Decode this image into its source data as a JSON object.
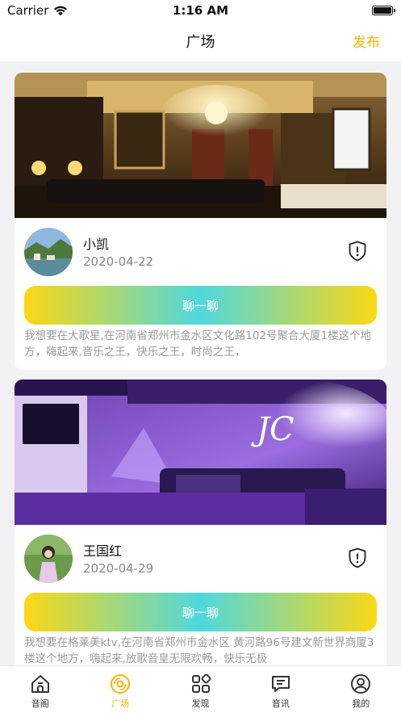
{
  "status_bar": {
    "carrier": "Carrier",
    "time": "1:16 AM"
  },
  "nav": {
    "title": "广场",
    "publish_label": "发布"
  },
  "posts": [
    {
      "username": "小凯",
      "date": "2020-04-22",
      "chat_label": "聊一聊",
      "description": "我想要在大歌星,在河南省郑州市金水区文化路102号聚合大厦1楼这个地方，嗨起来,音乐之王，快乐之王，时尚之王，"
    },
    {
      "username": "王国红",
      "date": "2020-04-29",
      "chat_label": "聊一聊",
      "description": "我想要在格莱美ktv,在河南省郑州市金水区 黄河路96号建文新世界商厦3楼这个地方，嗨起来,放歌音皇无限欢畅，快乐无极"
    }
  ],
  "tabs": [
    {
      "label": "音阁",
      "icon": "home-icon",
      "active": false
    },
    {
      "label": "广场",
      "icon": "disc-icon",
      "active": true
    },
    {
      "label": "发现",
      "icon": "grid-icon",
      "active": false
    },
    {
      "label": "音讯",
      "icon": "message-icon",
      "active": false
    },
    {
      "label": "我的",
      "icon": "profile-icon",
      "active": false
    }
  ],
  "colors": {
    "accent": "#f5b400",
    "gradient_start": "#fbd813",
    "gradient_mid": "#4fd8dd"
  }
}
